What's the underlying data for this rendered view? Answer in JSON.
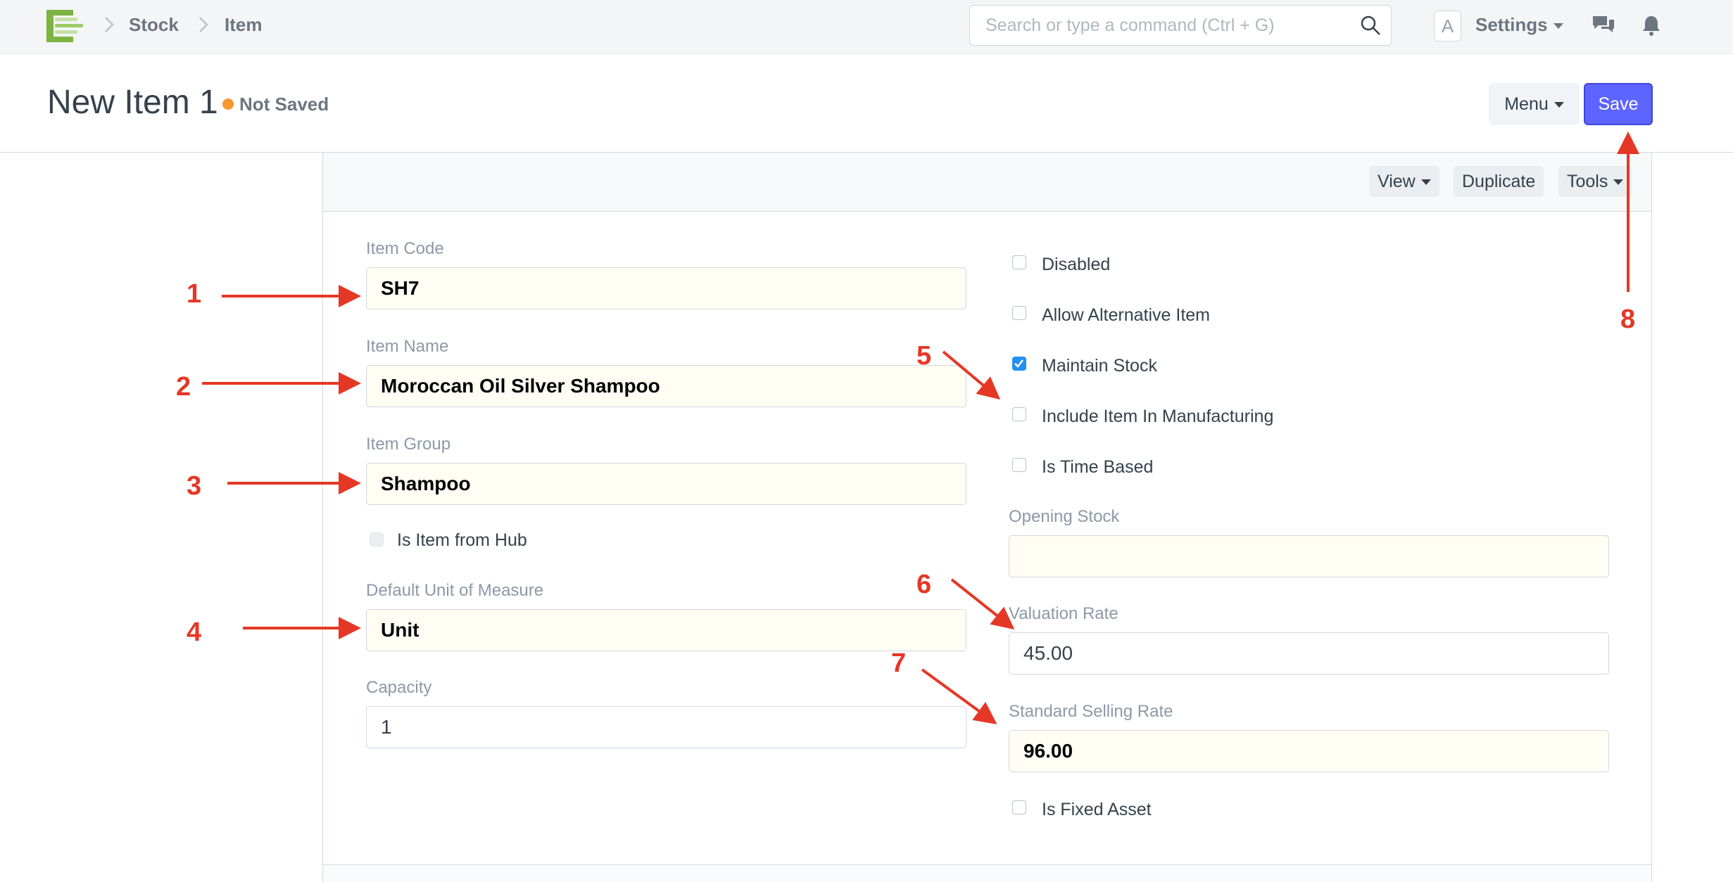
{
  "nav": {
    "breadcrumbs": [
      "Stock",
      "Item"
    ],
    "search_placeholder": "Search or type a command (Ctrl + G)",
    "avatar_letter": "A",
    "settings_label": "Settings"
  },
  "page": {
    "title": "New Item 1",
    "status": "Not Saved",
    "status_color": "#f8962f",
    "menu_label": "Menu",
    "save_label": "Save",
    "save_color": "#5e64ff"
  },
  "toolbar": {
    "view_label": "View",
    "duplicate_label": "Duplicate",
    "tools_label": "Tools"
  },
  "form": {
    "item_code": {
      "label": "Item Code",
      "value": "SH7"
    },
    "item_name": {
      "label": "Item Name",
      "value": "Moroccan Oil Silver Shampoo"
    },
    "item_group": {
      "label": "Item Group",
      "value": "Shampoo"
    },
    "is_item_from_hub": {
      "label": "Is Item from Hub",
      "checked": false
    },
    "uom": {
      "label": "Default Unit of Measure",
      "value": "Unit"
    },
    "capacity": {
      "label": "Capacity",
      "value": "1"
    },
    "disabled": {
      "label": "Disabled",
      "checked": false
    },
    "allow_alternative": {
      "label": "Allow Alternative Item",
      "checked": false
    },
    "maintain_stock": {
      "label": "Maintain Stock",
      "checked": true
    },
    "include_manufacturing": {
      "label": "Include Item In Manufacturing",
      "checked": false
    },
    "is_time_based": {
      "label": "Is Time Based",
      "checked": false
    },
    "opening_stock": {
      "label": "Opening Stock",
      "value": ""
    },
    "valuation_rate": {
      "label": "Valuation Rate",
      "value": "45.00"
    },
    "selling_rate": {
      "label": "Standard Selling Rate",
      "value": "96.00"
    },
    "is_fixed_asset": {
      "label": "Is Fixed Asset",
      "checked": false
    }
  },
  "annotations": [
    "1",
    "2",
    "3",
    "4",
    "5",
    "6",
    "7",
    "8"
  ],
  "annotation_color": "#e53725"
}
